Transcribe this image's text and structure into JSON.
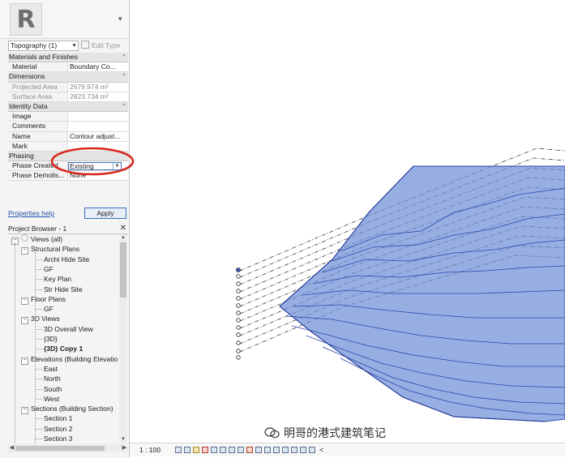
{
  "properties": {
    "app_logo_letter": "R",
    "type_selector": "Topography (1)",
    "edit_type_label": "Edit Type",
    "categories": [
      {
        "name": "Materials and Finishes",
        "rows": [
          {
            "name": "Material",
            "value": "Boundary Co..."
          }
        ]
      },
      {
        "name": "Dimensions",
        "rows": [
          {
            "name": "Projected Area",
            "value": "2679.974 m²"
          },
          {
            "name": "Surface Area",
            "value": "2823.734 m²"
          }
        ]
      },
      {
        "name": "Identity Data",
        "rows": [
          {
            "name": "Image",
            "value": ""
          },
          {
            "name": "Comments",
            "value": ""
          },
          {
            "name": "Name",
            "value": "Contour adjust..."
          },
          {
            "name": "Mark",
            "value": ""
          }
        ]
      },
      {
        "name": "Phasing",
        "rows": [
          {
            "name": "Phase Created",
            "value": "Existing"
          },
          {
            "name": "Phase Demolis...",
            "value": "None"
          }
        ]
      }
    ],
    "help_link": "Properties help",
    "apply_label": "Apply"
  },
  "project_browser": {
    "title": "Project Browser - 1",
    "items": [
      {
        "label": "Views (all)",
        "level": 0,
        "toggle": "−",
        "icon": true
      },
      {
        "label": "Structural Plans",
        "level": 1,
        "toggle": "−"
      },
      {
        "label": "Archi Hide Site",
        "level": 2
      },
      {
        "label": "GF",
        "level": 2
      },
      {
        "label": "Key Plan",
        "level": 2
      },
      {
        "label": "Str Hide Site",
        "level": 2
      },
      {
        "label": "Floor Plans",
        "level": 1,
        "toggle": "−"
      },
      {
        "label": "GF",
        "level": 2
      },
      {
        "label": "3D Views",
        "level": 1,
        "toggle": "−"
      },
      {
        "label": "3D Overall View",
        "level": 2
      },
      {
        "label": "{3D}",
        "level": 2
      },
      {
        "label": "{3D} Copy 1",
        "level": 2,
        "bold": true
      },
      {
        "label": "Elevations (Building Elevatio",
        "level": 1,
        "toggle": "−"
      },
      {
        "label": "East",
        "level": 2
      },
      {
        "label": "North",
        "level": 2
      },
      {
        "label": "South",
        "level": 2
      },
      {
        "label": "West",
        "level": 2
      },
      {
        "label": "Sections (Building Section)",
        "level": 1,
        "toggle": "−"
      },
      {
        "label": "Section 1",
        "level": 2
      },
      {
        "label": "Section 2",
        "level": 2
      },
      {
        "label": "Section 3",
        "level": 2
      }
    ]
  },
  "status_bar": {
    "scale": "1 : 100"
  },
  "watermark": "明哥的港式建筑笔记",
  "colors": {
    "surface_fill": "#6f8fd8",
    "contour_line": "#2a46a8",
    "highlight_circle": "#d9261c",
    "link": "#1f52a6"
  }
}
